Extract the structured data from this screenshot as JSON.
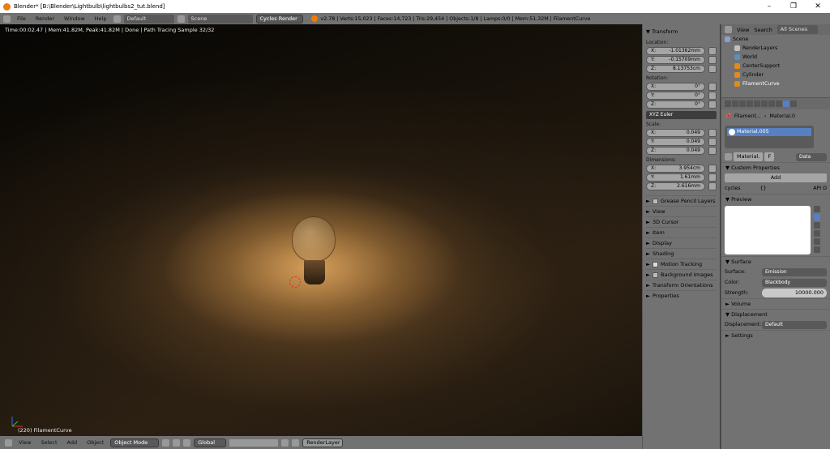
{
  "window": {
    "title": "Blender* [B:\\Blender\\Lightbulb\\lightbulbs2_tut.blend]",
    "controls": [
      "–",
      "❐",
      "✕"
    ]
  },
  "header": {
    "menus": [
      "File",
      "Render",
      "Window",
      "Help"
    ],
    "layout": "Default",
    "scene": "Scene",
    "engine": "Cycles Render",
    "stats": "v2.78 | Verts:15,023 | Faces:14,723 | Tris:29,454 | Objects:1/8 | Lamps:0/0 | Mem:51.32M | FilamentCurve"
  },
  "viewport": {
    "info": "Time:00:02.47 | Mem:41.82M, Peak:41.82M | Done | Path Tracing Sample 32/32",
    "object_label": "(220) FilamentCurve"
  },
  "npanel": {
    "transform": "▼ Transform",
    "location_label": "Location:",
    "location": [
      {
        "axis": "X:",
        "value": "-1.01362mm"
      },
      {
        "axis": "Y:",
        "value": "-0.15709mm"
      },
      {
        "axis": "Z:",
        "value": "8.13753cm"
      }
    ],
    "rotation_label": "Rotation:",
    "rotation": [
      {
        "axis": "X:",
        "value": "0°"
      },
      {
        "axis": "Y:",
        "value": "0°"
      },
      {
        "axis": "Z:",
        "value": "0°"
      }
    ],
    "rotation_mode": "XYZ Euler",
    "scale_label": "Scale:",
    "scale": [
      {
        "axis": "X:",
        "value": "0.049"
      },
      {
        "axis": "Y:",
        "value": "0.049"
      },
      {
        "axis": "Z:",
        "value": "0.049"
      }
    ],
    "dimensions_label": "Dimensions:",
    "dimensions": [
      {
        "axis": "X:",
        "value": "3.954cm"
      },
      {
        "axis": "Y:",
        "value": "1.61mm"
      },
      {
        "axis": "Z:",
        "value": "2.616mm"
      }
    ],
    "subpanels": [
      {
        "label": "Grease Pencil Layers",
        "check": false
      },
      {
        "label": "View"
      },
      {
        "label": "3D Cursor"
      },
      {
        "label": "Item"
      },
      {
        "label": "Display"
      },
      {
        "label": "Shading"
      },
      {
        "label": "Motion Tracking",
        "check": true
      },
      {
        "label": "Background Images",
        "check": false
      },
      {
        "label": "Transform Orientations"
      },
      {
        "label": "Properties"
      }
    ]
  },
  "outliner": {
    "view": "View",
    "search": "Search",
    "filter": "All Scenes",
    "items": [
      {
        "label": "Scene",
        "color": "#8aa0d0"
      },
      {
        "label": "RenderLayers",
        "color": "#c0c0c0"
      },
      {
        "label": "World",
        "color": "#5a8fc0"
      },
      {
        "label": "CenterSupport",
        "color": "#e08a20"
      },
      {
        "label": "Cylinder",
        "color": "#e08a20"
      },
      {
        "label": "FilamentCurve",
        "color": "#e08a20"
      }
    ]
  },
  "properties": {
    "breadcrumb_object": "Filament...",
    "breadcrumb_material": "Material.0",
    "material_slot": "Material.005",
    "material_name": "Material.",
    "material_f": "F",
    "link": "Data",
    "custom_properties": "▼ Custom Properties",
    "add": "Add",
    "prop_name": "cycles",
    "prop_value": "{}",
    "prop_api": "API D",
    "preview": "▼ Preview",
    "surface_header": "▼ Surface",
    "surface_label": "Surface:",
    "surface_value": "Emission",
    "color_label": "Color:",
    "color_value": "Blackbody",
    "strength_label": "Strength:",
    "strength_value": "10000.000",
    "volume": "► Volume",
    "displacement_header": "▼ Displacement",
    "displacement_label": "Displacement:",
    "displacement_value": "Default",
    "settings": "► Settings"
  },
  "bottombar": {
    "menus": [
      "View",
      "Select",
      "Add",
      "Object"
    ],
    "mode": "Object Mode",
    "orientation": "Global",
    "render_layer": "RenderLayer"
  }
}
